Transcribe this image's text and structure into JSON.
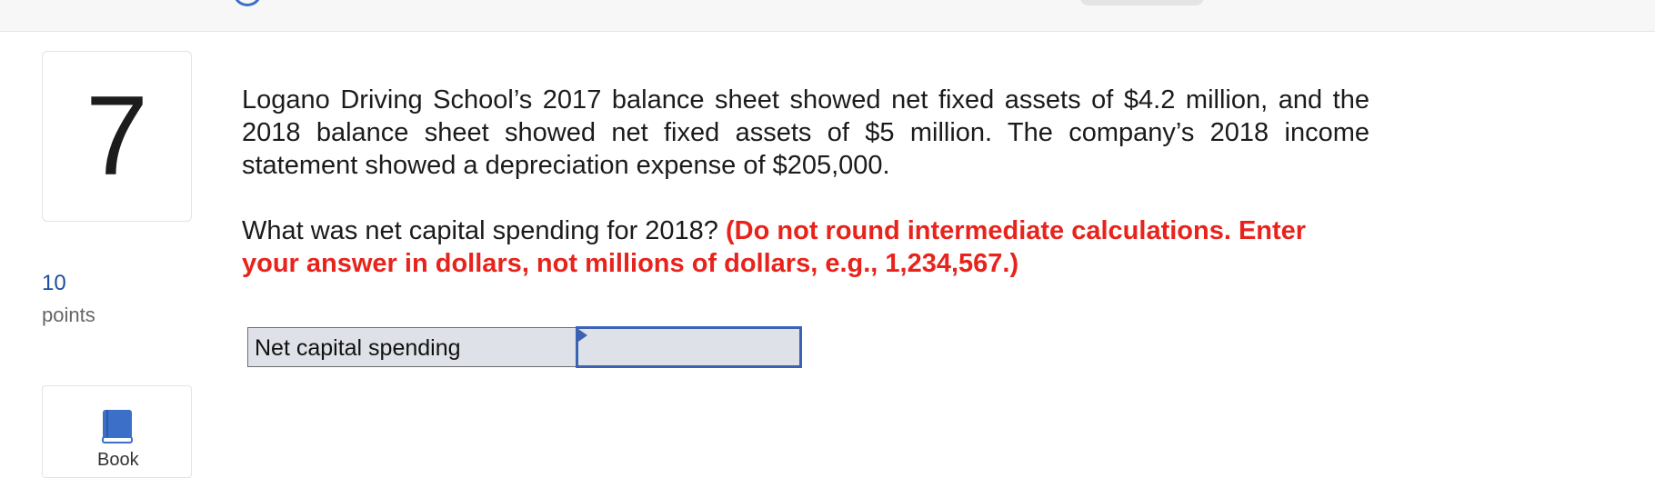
{
  "question": {
    "number": "7",
    "points_value": "10",
    "points_label": "points",
    "paragraph_1": "Logano Driving School’s 2017 balance sheet showed net fixed assets of $4.2 million, and the 2018 balance sheet showed net fixed assets of $5 million. The company’s 2018 income statement showed a depreciation expense of $205,000.",
    "prompt": "What was net capital spending for 2018?",
    "instruction": "(Do not round intermediate calculations. Enter your answer in dollars, not millions of dollars, e.g., 1,234,567.)"
  },
  "answer": {
    "label": "Net capital spending",
    "value": ""
  },
  "reference": {
    "label": "Book",
    "icon": "book-icon"
  },
  "colors": {
    "accent": "#3c63b3",
    "instruction_red": "#e8231c",
    "points_blue": "#1f4e9c"
  }
}
